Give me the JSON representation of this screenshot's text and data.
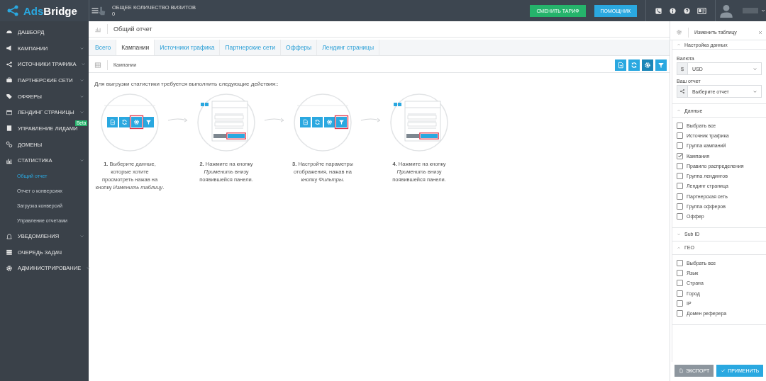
{
  "topbar": {
    "logo": {
      "text_1": "Ads",
      "text_2": "Bridge"
    },
    "visits_label": "ОБЩЕЕ КОЛИЧЕСТВО ВИЗИТОВ",
    "visits_value": "0",
    "buttons": [
      {
        "label": "СМЕНИТЬ ТАРИФ",
        "kind": "green"
      },
      {
        "label": "ПОМОЩНИК",
        "kind": "blue"
      }
    ]
  },
  "sidebar": {
    "items": [
      {
        "label": "ДАШБОРД",
        "expandable": false
      },
      {
        "label": "КАМПАНИИ",
        "expandable": true
      },
      {
        "label": "ИСТОЧНИКИ ТРАФИКА",
        "expandable": true
      },
      {
        "label": "ПАРТНЕРСКИЕ СЕТИ",
        "expandable": true
      },
      {
        "label": "ОФФЕРЫ",
        "expandable": true
      },
      {
        "label": "ЛЕНДИНГ СТРАНИЦЫ",
        "expandable": true
      },
      {
        "label": "УПРАВЛЕНИЕ ЛИДАМИ",
        "expandable": false,
        "badge": "Beta"
      },
      {
        "label": "ДОМЕНЫ",
        "expandable": false
      },
      {
        "label": "СТАТИСТИКА",
        "expandable": true,
        "children": [
          {
            "label": "Общий отчет",
            "selected": true
          },
          {
            "label": "Отчет о конверсиях",
            "selected": false
          },
          {
            "label": "Загрузка конверсий",
            "selected": false
          },
          {
            "label": "Управление отчетами",
            "selected": false
          }
        ]
      },
      {
        "label": "УВЕДОМЛЕНИЯ",
        "expandable": true
      },
      {
        "label": "ОЧЕРЕДЬ ЗАДАЧ",
        "expandable": false
      },
      {
        "label": "АДМИНИСТРИРОВАНИЕ",
        "expandable": true
      }
    ]
  },
  "page": {
    "title": "Общий отчет",
    "tabs": [
      {
        "label": "Всего",
        "selected": false
      },
      {
        "label": "Кампании",
        "selected": true
      },
      {
        "label": "Источники трафика",
        "selected": false
      },
      {
        "label": "Партнерские сети",
        "selected": false
      },
      {
        "label": "Офферы",
        "selected": false
      },
      {
        "label": "Лендинг страницы",
        "selected": false
      }
    ],
    "toolbar_title": "Кампании",
    "toolbar_buttons": [
      {
        "kind": "export",
        "active": false
      },
      {
        "kind": "refresh",
        "active": false
      },
      {
        "kind": "settings",
        "active": true
      },
      {
        "kind": "filter",
        "active": false
      }
    ],
    "instructions": "Для выгрузки статистики требуется выполнить следующие действия::",
    "steps": [
      {
        "kind": "settings",
        "text": "**1.** Выберите данные, которые хотите просмотреть нажав на кнопку *Изменить таблицу*."
      },
      {
        "kind": "panel",
        "text": "**2.** Нажмите на кнопку *Применить* внизу появившейся панели."
      },
      {
        "kind": "filter",
        "text": "**3.** Настройте параметры отображения, нажав на кнопку *Фильтры*."
      },
      {
        "kind": "panel",
        "text": "**4.** Нажмите на кнопку *Применить* внизу появившейся панели."
      }
    ]
  },
  "panel": {
    "title": "Изменить таблицу",
    "sections": [
      {
        "title": "Настройка данных",
        "expanded": true,
        "fields": [
          {
            "label": "Валюта",
            "kind": "text",
            "addon": "$",
            "value": "USD"
          },
          {
            "label": "Ваш отчет",
            "kind": "icon",
            "value": "Выберите отчет"
          }
        ]
      },
      {
        "title": "Данные",
        "expanded": true,
        "options": [
          {
            "label": "Выбрать все",
            "checked": false
          },
          {
            "label": "Источник трафика",
            "checked": false
          },
          {
            "label": "Группа кампаний",
            "checked": false
          },
          {
            "label": "Кампания",
            "checked": true
          },
          {
            "label": "Правило распределения",
            "checked": false
          },
          {
            "label": "Группа лендингов",
            "checked": false
          },
          {
            "label": "Лендинг страница",
            "checked": false
          },
          {
            "label": "Партнерская сеть",
            "checked": false
          },
          {
            "label": "Группа офферов",
            "checked": false
          },
          {
            "label": "Оффер",
            "checked": false
          }
        ]
      },
      {
        "title": "Sub ID",
        "expanded": false
      },
      {
        "title": "ГЕО",
        "expanded": true,
        "options": [
          {
            "label": "Выбрать все",
            "checked": false
          },
          {
            "label": "Язык",
            "checked": false
          },
          {
            "label": "Страна",
            "checked": false
          },
          {
            "label": "Город",
            "checked": false
          },
          {
            "label": "IP",
            "checked": false
          },
          {
            "label": "Домен реферера",
            "checked": false
          }
        ]
      }
    ],
    "export_button": "ЭКСПОРТ",
    "apply_button": "ПРИМЕНИТЬ"
  }
}
